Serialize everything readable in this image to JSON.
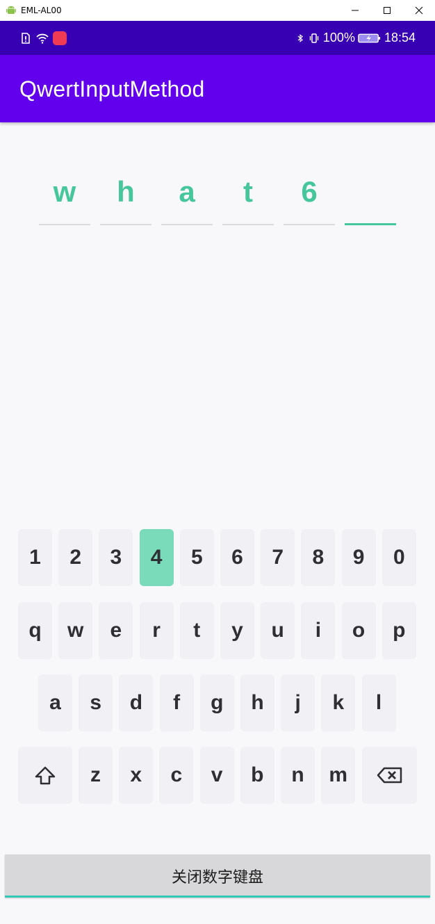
{
  "window": {
    "title": "EML-AL00"
  },
  "status_bar": {
    "battery": "100%",
    "time": "18:54"
  },
  "app_bar": {
    "title": "QwertInputMethod"
  },
  "pin": {
    "chars": [
      "w",
      "h",
      "a",
      "t",
      "6",
      ""
    ],
    "active_index": 5,
    "accent_color": "#46c69b"
  },
  "keyboard": {
    "row1": [
      "1",
      "2",
      "3",
      "4",
      "5",
      "6",
      "7",
      "8",
      "9",
      "0"
    ],
    "row2": [
      "q",
      "w",
      "e",
      "r",
      "t",
      "y",
      "u",
      "i",
      "o",
      "p"
    ],
    "row3": [
      "a",
      "s",
      "d",
      "f",
      "g",
      "h",
      "j",
      "k",
      "l"
    ],
    "row4": [
      "z",
      "x",
      "c",
      "v",
      "b",
      "n",
      "m"
    ],
    "shift_icon": "shift-arrow-icon",
    "backspace_icon": "backspace-icon",
    "pressed_key": "4",
    "pressed_color": "#79dbb9"
  },
  "close_button": {
    "label": "关闭数字键盘"
  },
  "colors": {
    "status_bar": "#3700b3",
    "app_bar": "#6200ee",
    "underline": "#33c9b6"
  }
}
